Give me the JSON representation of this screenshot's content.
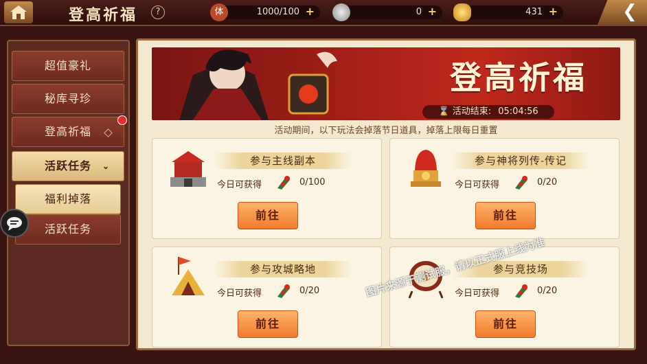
{
  "header": {
    "title": "登高祈福",
    "help": "?",
    "resources": [
      {
        "name": "stamina",
        "icon": "stamina-icon",
        "label": "体",
        "value": "1000/100"
      },
      {
        "name": "silver",
        "icon": "coin-icon",
        "value": "0"
      },
      {
        "name": "gold",
        "icon": "gold-ingot-icon",
        "value": "431"
      }
    ]
  },
  "sidebar": {
    "items": [
      {
        "label": "超值豪礼"
      },
      {
        "label": "秘库寻珍"
      },
      {
        "label": "登高祈福"
      },
      {
        "label": "活跃任务"
      },
      {
        "label": "福利掉落"
      },
      {
        "label": "活跃任务"
      }
    ]
  },
  "banner": {
    "title": "登高祈福",
    "timer_label": "活动结束:",
    "timer_value": "05:04:56"
  },
  "notice": "活动期间，以下玩法会掉落节日道具，掉落上限每日重置",
  "cards": [
    {
      "title": "参与主线副本",
      "today_label": "今日可获得",
      "count": "0/100",
      "button": "前往"
    },
    {
      "title": "参与神将列传-传记",
      "today_label": "今日可获得",
      "count": "0/20",
      "button": "前往"
    },
    {
      "title": "参与攻城略地",
      "today_label": "今日可获得",
      "count": "0/20",
      "button": "前往"
    },
    {
      "title": "参与竞技场",
      "today_label": "今日可获得",
      "count": "0/20",
      "button": "前往"
    }
  ],
  "watermark": "图片来源于测试服，请以正式服上线为准",
  "colors": {
    "accent": "#f07a2c",
    "banner": "#a52018",
    "panel": "#f4e8cf"
  }
}
